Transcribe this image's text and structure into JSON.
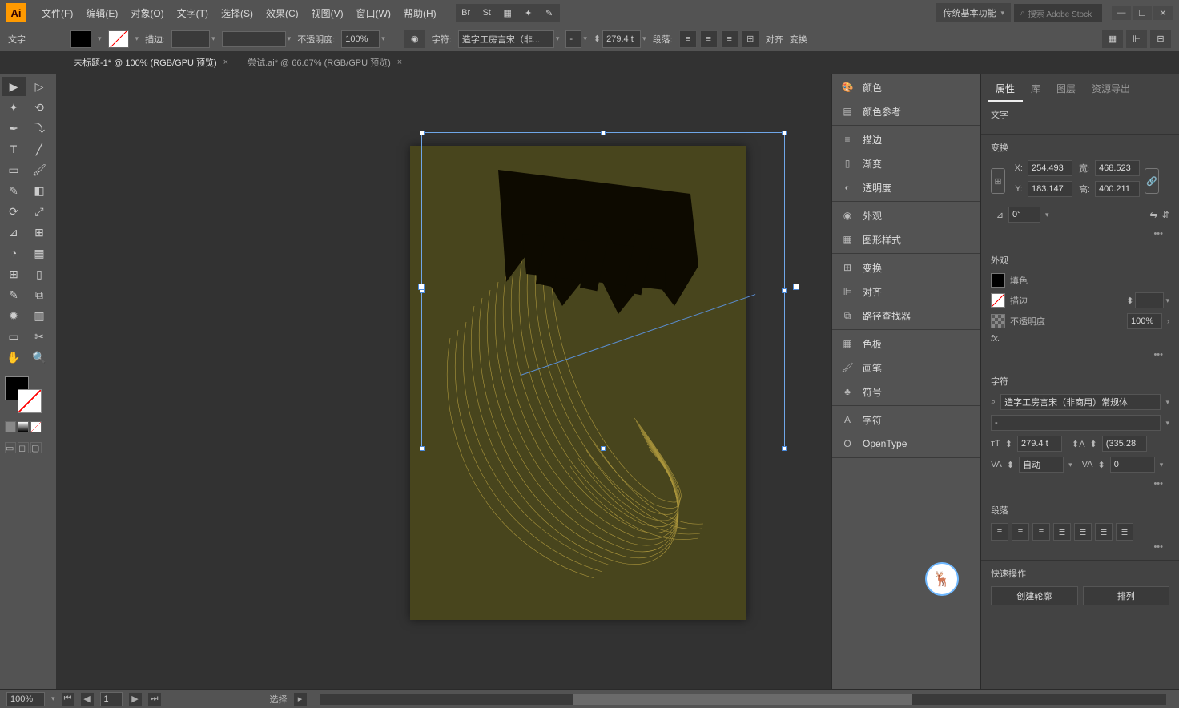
{
  "app": {
    "name": "Ai"
  },
  "menus": [
    "文件(F)",
    "编辑(E)",
    "对象(O)",
    "文字(T)",
    "选择(S)",
    "效果(C)",
    "视图(V)",
    "窗口(W)",
    "帮助(H)"
  ],
  "menubar_icons": [
    "Br",
    "St",
    "layout-icon",
    "star-icon",
    "quill-icon"
  ],
  "workspace": {
    "label": "传统基本功能",
    "search_placeholder": "搜索 Adobe Stock"
  },
  "control": {
    "type_label": "文字",
    "stroke_label": "描边:",
    "opacity_label": "不透明度:",
    "opacity_value": "100%",
    "char_label": "字符:",
    "font_name": "造字工房言宋（非...",
    "size_value": "279.4 t",
    "para_label": "段落:",
    "align_label": "对齐",
    "transform_label": "变换"
  },
  "tabs": [
    {
      "label": "未标题-1* @ 100% (RGB/GPU 预览)",
      "active": true
    },
    {
      "label": "尝试.ai* @ 66.67% (RGB/GPU 预览)",
      "active": false
    }
  ],
  "mid_panels": [
    {
      "group": [
        {
          "icon": "palette",
          "label": "颜色"
        },
        {
          "icon": "guide",
          "label": "颜色参考"
        }
      ]
    },
    {
      "group": [
        {
          "icon": "stroke",
          "label": "描边"
        },
        {
          "icon": "gradient",
          "label": "渐变"
        },
        {
          "icon": "transparency",
          "label": "透明度"
        }
      ]
    },
    {
      "group": [
        {
          "icon": "appearance",
          "label": "外观"
        },
        {
          "icon": "graphic-styles",
          "label": "图形样式"
        }
      ]
    },
    {
      "group": [
        {
          "icon": "transform",
          "label": "变换"
        },
        {
          "icon": "align",
          "label": "对齐"
        },
        {
          "icon": "pathfinder",
          "label": "路径查找器"
        }
      ]
    },
    {
      "group": [
        {
          "icon": "swatches",
          "label": "色板"
        },
        {
          "icon": "brushes",
          "label": "画笔"
        },
        {
          "icon": "symbols",
          "label": "符号"
        }
      ]
    },
    {
      "group": [
        {
          "icon": "character",
          "label": "字符"
        },
        {
          "icon": "opentype",
          "label": "OpenType"
        }
      ]
    }
  ],
  "right_tabs": [
    "属性",
    "库",
    "图层",
    "资源导出"
  ],
  "properties": {
    "selection_type": "文字",
    "transform": {
      "title": "变换",
      "x": "254.493",
      "y": "183.147",
      "w": "468.523",
      "h": "400.211",
      "angle": "0°"
    },
    "appearance": {
      "title": "外观",
      "fill": "填色",
      "stroke": "描边",
      "opacity_label": "不透明度",
      "opacity_value": "100%",
      "fx": "fx."
    },
    "character": {
      "title": "字符",
      "font": "造字工房言宋（非商用）常规体",
      "style": "-",
      "size": "279.4 t",
      "leading": "(335.28",
      "kerning": "自动",
      "tracking": "0"
    },
    "paragraph": {
      "title": "段落"
    },
    "quick": {
      "title": "快速操作",
      "btn1": "创建轮廓",
      "btn2": "排列"
    }
  },
  "status": {
    "zoom": "100%",
    "page": "1",
    "mode": "选择"
  }
}
